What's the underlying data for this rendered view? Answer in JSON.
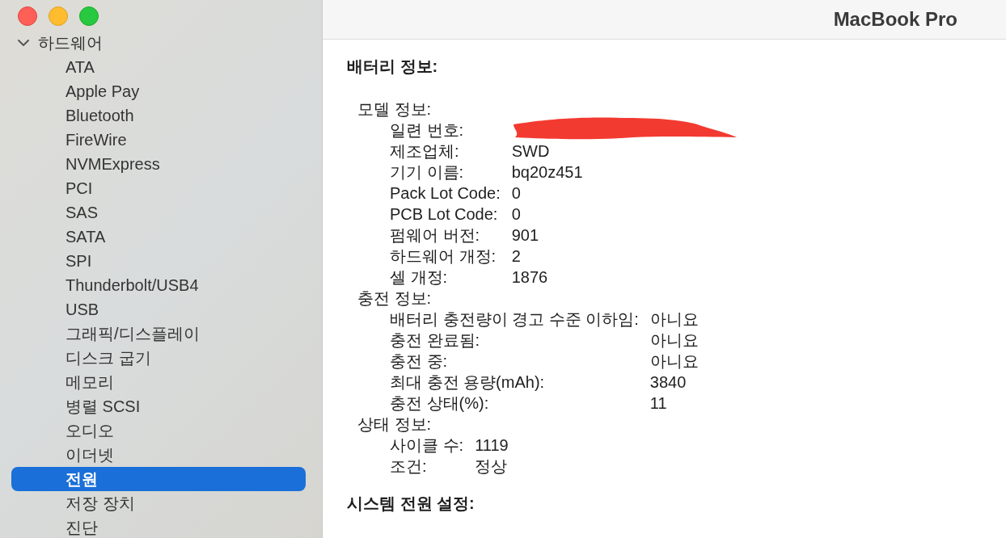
{
  "window": {
    "title": "MacBook Pro"
  },
  "sidebar": {
    "items": [
      {
        "label": "하드웨어",
        "expanded": true,
        "children": [
          {
            "label": "ATA",
            "selected": false
          },
          {
            "label": "Apple Pay",
            "selected": false
          },
          {
            "label": "Bluetooth",
            "selected": false
          },
          {
            "label": "FireWire",
            "selected": false
          },
          {
            "label": "NVMExpress",
            "selected": false
          },
          {
            "label": "PCI",
            "selected": false
          },
          {
            "label": "SAS",
            "selected": false
          },
          {
            "label": "SATA",
            "selected": false
          },
          {
            "label": "SPI",
            "selected": false
          },
          {
            "label": "Thunderbolt/USB4",
            "selected": false
          },
          {
            "label": "USB",
            "selected": false
          },
          {
            "label": "그래픽/디스플레이",
            "selected": false
          },
          {
            "label": "디스크 굽기",
            "selected": false
          },
          {
            "label": "메모리",
            "selected": false
          },
          {
            "label": "병렬 SCSI",
            "selected": false
          },
          {
            "label": "오디오",
            "selected": false
          },
          {
            "label": "이더넷",
            "selected": false
          },
          {
            "label": "전원",
            "selected": true
          },
          {
            "label": "저장 장치",
            "selected": false
          },
          {
            "label": "진단",
            "selected": false
          }
        ]
      }
    ]
  },
  "content": {
    "sections": [
      {
        "title": "배터리 정보:",
        "groups": [
          {
            "label": "모델 정보:",
            "rows": [
              {
                "key": "일련 번호:",
                "redacted": true
              },
              {
                "key": "제조업체:",
                "value": "SWD"
              },
              {
                "key": "기기 이름:",
                "value": "bq20z451"
              },
              {
                "key": "Pack Lot Code:",
                "value": "0"
              },
              {
                "key": "PCB Lot Code:",
                "value": "0"
              },
              {
                "key": "펌웨어 버전:",
                "value": "901"
              },
              {
                "key": "하드웨어 개정:",
                "value": "2"
              },
              {
                "key": "셀 개정:",
                "value": "1876"
              }
            ]
          },
          {
            "label": "충전 정보:",
            "rows": [
              {
                "key": "배터리 충전량이 경고 수준 이하임:",
                "value": "아니요"
              },
              {
                "key": "충전 완료됨:",
                "value": "아니요"
              },
              {
                "key": "충전 중:",
                "value": "아니요"
              },
              {
                "key": "최대 충전 용량(mAh):",
                "value": "3840"
              },
              {
                "key": "충전 상태(%):",
                "value": "11"
              }
            ]
          },
          {
            "label": "상태 정보:",
            "rows": [
              {
                "key": "사이클 수:",
                "value": "1119"
              },
              {
                "key": "조건:",
                "value": "정상"
              }
            ]
          }
        ]
      },
      {
        "title": "시스템 전원 설정:"
      }
    ]
  }
}
